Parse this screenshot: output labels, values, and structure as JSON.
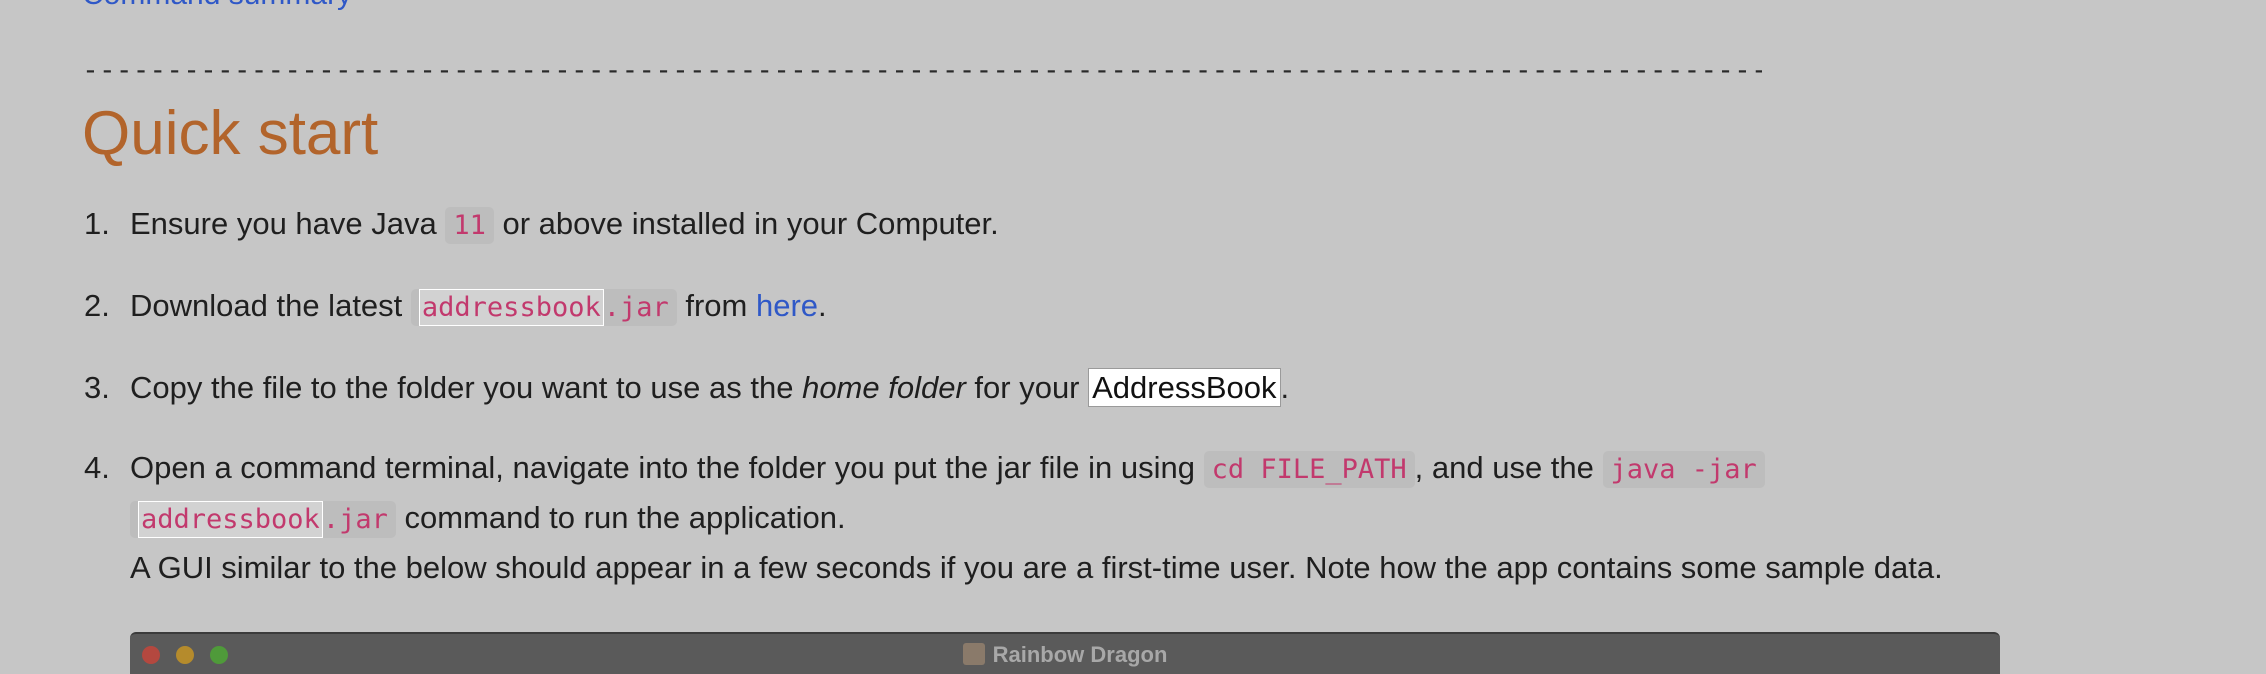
{
  "top_link": {
    "label": "Command summary"
  },
  "divider": "-------------------------------------------------------------------------------------------------------",
  "section": {
    "title": "Quick start"
  },
  "steps": [
    {
      "num": "1.",
      "pre": "Ensure you have Java ",
      "code": "11",
      "post": " or above installed in your Computer."
    },
    {
      "num": "2.",
      "pre": "Download the latest ",
      "code_a": "addressbook",
      "code_b": ".jar",
      "mid": " from ",
      "link": "here",
      "post": "."
    },
    {
      "num": "3.",
      "pre": "Copy the file to the folder you want to use as the ",
      "emph": "home folder",
      "mid": " for your ",
      "boxed": "AddressBook",
      "post": "."
    },
    {
      "num": "4.",
      "pre": "Open a command terminal, navigate into the folder you put the jar file in using ",
      "code1": "cd FILE_PATH",
      "mid": ", and use the ",
      "code2": "java -jar",
      "code3_a": "addressbook",
      "code3_b": ".jar",
      "post": " command to run the application.",
      "note": "A GUI similar to the below should appear in a few seconds if you are a first-time user. Note how the app contains some sample data."
    }
  ],
  "window": {
    "title": "Rainbow Dragon"
  },
  "colors": {
    "background": "#c6c6c6",
    "heading": "#b2642b",
    "link": "#2f58c7",
    "code_text": "#c2396d"
  }
}
